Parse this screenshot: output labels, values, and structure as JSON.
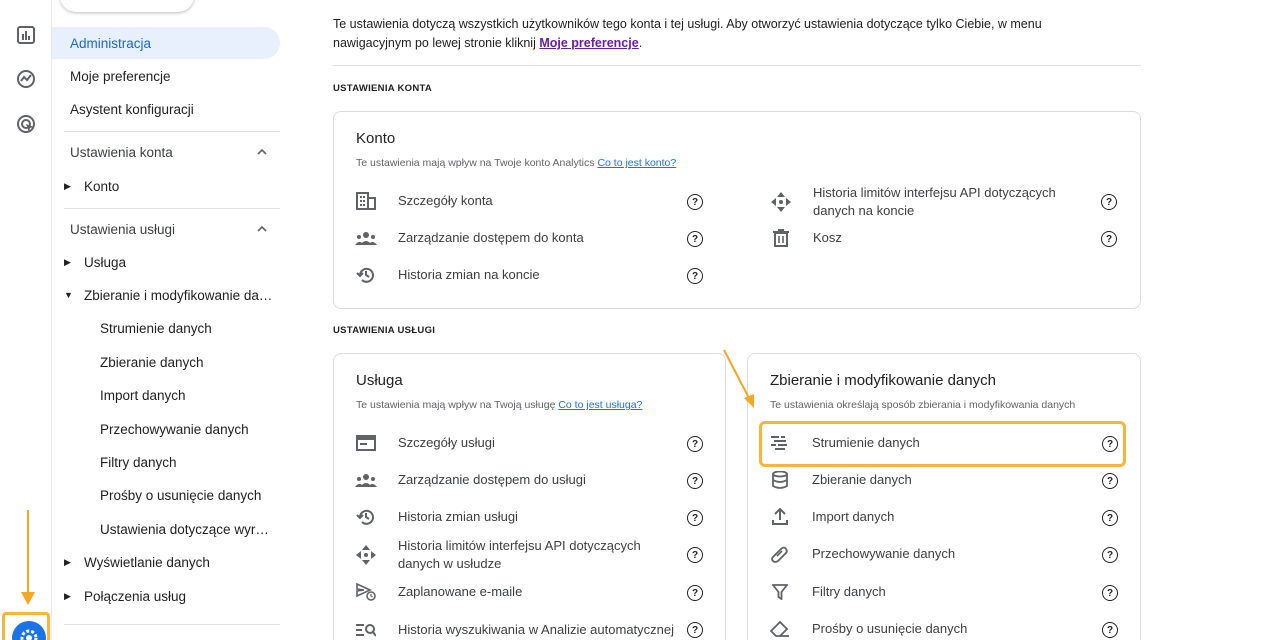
{
  "sidebar": {
    "admin": "Administracja",
    "prefs": "Moje preferencje",
    "assistant": "Asystent konfiguracji",
    "account_section": "Ustawienia konta",
    "account_item": "Konto",
    "property_section": "Ustawienia usługi",
    "property_item": "Usługa",
    "collect_item": "Zbieranie i modyfikowanie danych",
    "sub_items": [
      "Strumienie danych",
      "Zbieranie danych",
      "Import danych",
      "Przechowywanie danych",
      "Filtry danych",
      "Prośby o usunięcie danych",
      "Ustawienia dotyczące wyrażeń"
    ],
    "display_item": "Wyświetlanie danych",
    "links_item": "Połączenia usług"
  },
  "main": {
    "intro_text": "Te ustawienia dotyczą wszystkich użytkowników tego konta i tej usługi. Aby otworzyć ustawienia dotyczące tylko Ciebie, w menu nawigacyjnym po lewej stronie kliknij ",
    "intro_link": "Moje preferencje",
    "intro_end": ".",
    "account_header": "USTAWIENIA KONTA",
    "property_header": "USTAWIENIA USŁUGI"
  },
  "account_card": {
    "title": "Konto",
    "subtitle": "Te ustawienia mają wpływ na Twoje konto Analytics ",
    "subtitle_link": "Co to jest konto?",
    "left": [
      "Szczegóły konta",
      "Zarządzanie dostępem do konta",
      "Historia zmian na koncie"
    ],
    "right": [
      "Historia limitów interfejsu API dotyczących danych na koncie",
      "Kosz"
    ]
  },
  "property_card": {
    "title": "Usługa",
    "subtitle": "Te ustawienia mają wpływ na Twoją usługę ",
    "subtitle_link": "Co to jest usługa?",
    "items": [
      "Szczegóły usługi",
      "Zarządzanie dostępem do usługi",
      "Historia zmian usługi",
      "Historia limitów interfejsu API dotyczących danych w usłudze",
      "Zaplanowane e-maile",
      "Historia wyszukiwania w Analizie automatycznej"
    ]
  },
  "collect_card": {
    "title": "Zbieranie i modyfikowanie danych",
    "subtitle": "Te ustawienia określają sposób zbierania i modyfikowania danych",
    "items": [
      "Strumienie danych",
      "Zbieranie danych",
      "Import danych",
      "Przechowywanie danych",
      "Filtry danych",
      "Prośby o usunięcie danych"
    ]
  },
  "help_glyph": "?",
  "colors": {
    "accent": "#1a73e8",
    "highlight": "#f5b53f",
    "active_bg": "#e8f0fe"
  }
}
